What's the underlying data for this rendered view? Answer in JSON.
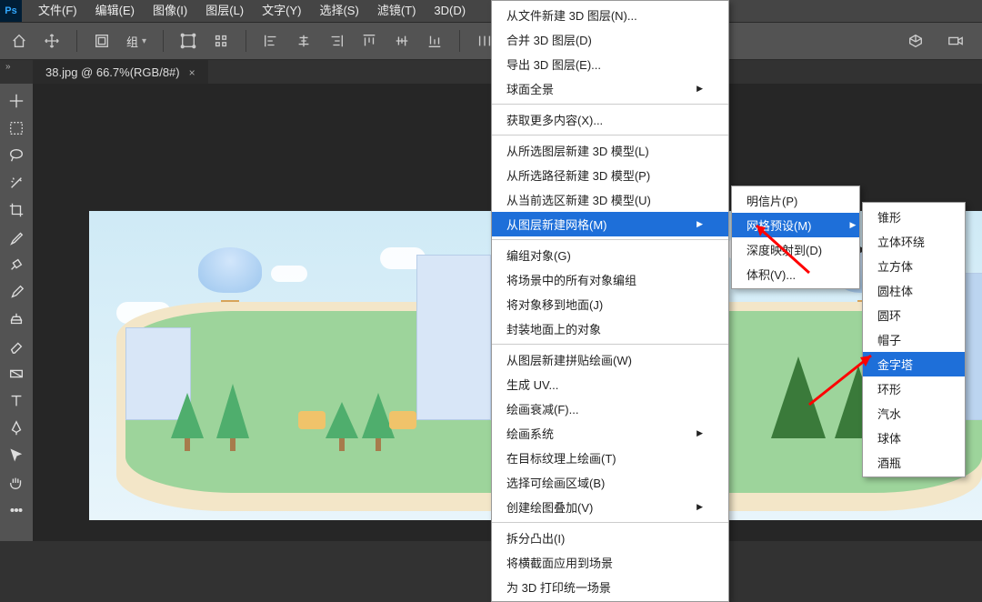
{
  "menubar": {
    "items": [
      "文件(F)",
      "编辑(E)",
      "图像(I)",
      "图层(L)",
      "文字(Y)",
      "选择(S)",
      "滤镜(T)",
      "3D(D)"
    ]
  },
  "optionsbar": {
    "group_label": "组"
  },
  "tab": {
    "title": "38.jpg @ 66.7%(RGB/8#)",
    "close": "×"
  },
  "menu_3d": {
    "items": [
      {
        "label": "从文件新建 3D 图层(N)..."
      },
      {
        "label": "合并 3D 图层(D)"
      },
      {
        "label": "导出 3D 图层(E)..."
      },
      {
        "label": "球面全景",
        "sub": true
      },
      {
        "sep": true
      },
      {
        "label": "获取更多内容(X)..."
      },
      {
        "sep": true
      },
      {
        "label": "从所选图层新建 3D 模型(L)"
      },
      {
        "label": "从所选路径新建 3D 模型(P)"
      },
      {
        "label": "从当前选区新建 3D 模型(U)"
      },
      {
        "label": "从图层新建网格(M)",
        "sub": true,
        "sel": true
      },
      {
        "sep": true
      },
      {
        "label": "编组对象(G)"
      },
      {
        "label": "将场景中的所有对象编组"
      },
      {
        "label": "将对象移到地面(J)"
      },
      {
        "label": "封装地面上的对象"
      },
      {
        "sep": true
      },
      {
        "label": "从图层新建拼贴绘画(W)"
      },
      {
        "label": "生成 UV..."
      },
      {
        "label": "绘画衰减(F)..."
      },
      {
        "label": "绘画系统",
        "sub": true
      },
      {
        "label": "在目标纹理上绘画(T)"
      },
      {
        "label": "选择可绘画区域(B)"
      },
      {
        "label": "创建绘图叠加(V)",
        "sub": true
      },
      {
        "sep": true
      },
      {
        "label": "拆分凸出(I)"
      },
      {
        "label": "将横截面应用到场景"
      },
      {
        "label": "为 3D 打印统一场景"
      }
    ]
  },
  "submenu1": {
    "items": [
      {
        "label": "明信片(P)"
      },
      {
        "label": "网格预设(M)",
        "sub": true,
        "sel": true
      },
      {
        "label": "深度映射到(D)",
        "sub": true
      },
      {
        "label": "体积(V)..."
      }
    ]
  },
  "submenu2": {
    "items": [
      {
        "label": "锥形"
      },
      {
        "label": "立体环绕"
      },
      {
        "label": "立方体"
      },
      {
        "label": "圆柱体"
      },
      {
        "label": "圆环"
      },
      {
        "label": "帽子"
      },
      {
        "label": "金字塔",
        "sel": true
      },
      {
        "label": "环形"
      },
      {
        "label": "汽水"
      },
      {
        "label": "球体"
      },
      {
        "label": "酒瓶"
      }
    ]
  }
}
